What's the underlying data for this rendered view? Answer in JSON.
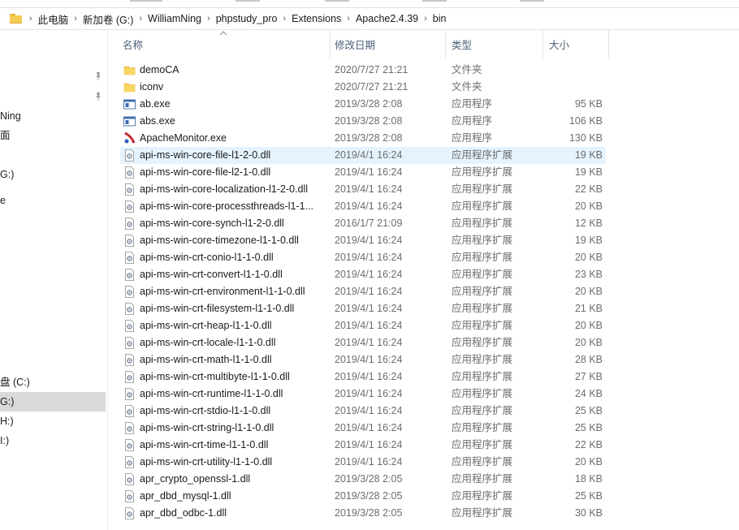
{
  "breadcrumb": [
    "此电脑",
    "新加卷 (G:)",
    "WilliamNing",
    "phpstudy_pro",
    "Extensions",
    "Apache2.4.39",
    "bin"
  ],
  "nav_items": [
    "Ning",
    "面",
    "G:)",
    "e",
    "盘 (C:)",
    "G:)",
    "H:)",
    "I:)"
  ],
  "columns": {
    "name": "名称",
    "date": "修改日期",
    "type": "类型",
    "size": "大小"
  },
  "files": [
    {
      "icon": "folder-icon",
      "name": "demoCA",
      "date": "2020/7/27 21:21",
      "type": "文件夹",
      "size": ""
    },
    {
      "icon": "folder-icon",
      "name": "iconv",
      "date": "2020/7/27 21:21",
      "type": "文件夹",
      "size": ""
    },
    {
      "icon": "exe-icon",
      "name": "ab.exe",
      "date": "2019/3/28 2:08",
      "type": "应用程序",
      "size": "95 KB"
    },
    {
      "icon": "exe-icon",
      "name": "abs.exe",
      "date": "2019/3/28 2:08",
      "type": "应用程序",
      "size": "106 KB"
    },
    {
      "icon": "apache-monitor-icon",
      "name": "ApacheMonitor.exe",
      "date": "2019/3/28 2:08",
      "type": "应用程序",
      "size": "130 KB"
    },
    {
      "icon": "dll-icon",
      "name": "api-ms-win-core-file-l1-2-0.dll",
      "date": "2019/4/1 16:24",
      "type": "应用程序扩展",
      "size": "19 KB"
    },
    {
      "icon": "dll-icon",
      "name": "api-ms-win-core-file-l2-1-0.dll",
      "date": "2019/4/1 16:24",
      "type": "应用程序扩展",
      "size": "19 KB"
    },
    {
      "icon": "dll-icon",
      "name": "api-ms-win-core-localization-l1-2-0.dll",
      "date": "2019/4/1 16:24",
      "type": "应用程序扩展",
      "size": "22 KB"
    },
    {
      "icon": "dll-icon",
      "name": "api-ms-win-core-processthreads-l1-1...",
      "date": "2019/4/1 16:24",
      "type": "应用程序扩展",
      "size": "20 KB"
    },
    {
      "icon": "dll-icon",
      "name": "api-ms-win-core-synch-l1-2-0.dll",
      "date": "2016/1/7 21:09",
      "type": "应用程序扩展",
      "size": "12 KB"
    },
    {
      "icon": "dll-icon",
      "name": "api-ms-win-core-timezone-l1-1-0.dll",
      "date": "2019/4/1 16:24",
      "type": "应用程序扩展",
      "size": "19 KB"
    },
    {
      "icon": "dll-icon",
      "name": "api-ms-win-crt-conio-l1-1-0.dll",
      "date": "2019/4/1 16:24",
      "type": "应用程序扩展",
      "size": "20 KB"
    },
    {
      "icon": "dll-icon",
      "name": "api-ms-win-crt-convert-l1-1-0.dll",
      "date": "2019/4/1 16:24",
      "type": "应用程序扩展",
      "size": "23 KB"
    },
    {
      "icon": "dll-icon",
      "name": "api-ms-win-crt-environment-l1-1-0.dll",
      "date": "2019/4/1 16:24",
      "type": "应用程序扩展",
      "size": "20 KB"
    },
    {
      "icon": "dll-icon",
      "name": "api-ms-win-crt-filesystem-l1-1-0.dll",
      "date": "2019/4/1 16:24",
      "type": "应用程序扩展",
      "size": "21 KB"
    },
    {
      "icon": "dll-icon",
      "name": "api-ms-win-crt-heap-l1-1-0.dll",
      "date": "2019/4/1 16:24",
      "type": "应用程序扩展",
      "size": "20 KB"
    },
    {
      "icon": "dll-icon",
      "name": "api-ms-win-crt-locale-l1-1-0.dll",
      "date": "2019/4/1 16:24",
      "type": "应用程序扩展",
      "size": "20 KB"
    },
    {
      "icon": "dll-icon",
      "name": "api-ms-win-crt-math-l1-1-0.dll",
      "date": "2019/4/1 16:24",
      "type": "应用程序扩展",
      "size": "28 KB"
    },
    {
      "icon": "dll-icon",
      "name": "api-ms-win-crt-multibyte-l1-1-0.dll",
      "date": "2019/4/1 16:24",
      "type": "应用程序扩展",
      "size": "27 KB"
    },
    {
      "icon": "dll-icon",
      "name": "api-ms-win-crt-runtime-l1-1-0.dll",
      "date": "2019/4/1 16:24",
      "type": "应用程序扩展",
      "size": "24 KB"
    },
    {
      "icon": "dll-icon",
      "name": "api-ms-win-crt-stdio-l1-1-0.dll",
      "date": "2019/4/1 16:24",
      "type": "应用程序扩展",
      "size": "25 KB"
    },
    {
      "icon": "dll-icon",
      "name": "api-ms-win-crt-string-l1-1-0.dll",
      "date": "2019/4/1 16:24",
      "type": "应用程序扩展",
      "size": "25 KB"
    },
    {
      "icon": "dll-icon",
      "name": "api-ms-win-crt-time-l1-1-0.dll",
      "date": "2019/4/1 16:24",
      "type": "应用程序扩展",
      "size": "22 KB"
    },
    {
      "icon": "dll-icon",
      "name": "api-ms-win-crt-utility-l1-1-0.dll",
      "date": "2019/4/1 16:24",
      "type": "应用程序扩展",
      "size": "20 KB"
    },
    {
      "icon": "dll-icon",
      "name": "apr_crypto_openssl-1.dll",
      "date": "2019/3/28 2:05",
      "type": "应用程序扩展",
      "size": "18 KB"
    },
    {
      "icon": "dll-icon",
      "name": "apr_dbd_mysql-1.dll",
      "date": "2019/3/28 2:05",
      "type": "应用程序扩展",
      "size": "25 KB"
    },
    {
      "icon": "dll-icon",
      "name": "apr_dbd_odbc-1.dll",
      "date": "2019/3/28 2:05",
      "type": "应用程序扩展",
      "size": "30 KB"
    }
  ],
  "highlighted_row": 5,
  "colors": {
    "highlight": "#e5f3ff",
    "nav_selected": "#d9d9d9",
    "folder": "#f6cc52"
  }
}
